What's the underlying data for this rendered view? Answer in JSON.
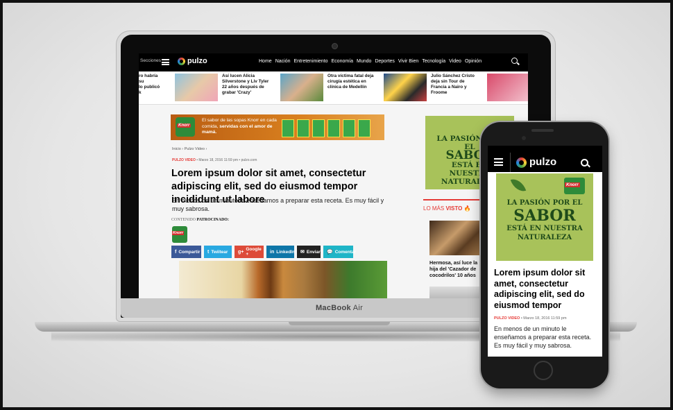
{
  "site": {
    "secciones": "Secciones",
    "logo": "pulzo",
    "nav": [
      "Home",
      "Nación",
      "Entretenimiento",
      "Economía",
      "Mundo",
      "Deportes",
      "Vivir Bien",
      "Tecnología",
      "Video",
      "Opinión"
    ]
  },
  "stories": [
    {
      "text": "ro habría\nsu\nlo publicó\nk"
    },
    {
      "text": "Así lucen Alicia Silverstone y Liv Tyler 22 años después de grabar 'Crazy'"
    },
    {
      "text": "Otra víctima fatal deja cirugía estética en clínica de Medellín"
    },
    {
      "text": "Julio Sánchez Cristo deja sin Tour de Francia a Nairo y Froome"
    }
  ],
  "banner_ad": {
    "brand": "Knorr",
    "text_plain": "El sabor de las sopas Knorr en cada comida,",
    "text_bold": "servidas con el amor de mamá."
  },
  "article": {
    "breadcrumb": "Inicio › Pulzo Video ›",
    "category": "PULZO VIDEO",
    "date_source": "• Marzo 18, 2016 11:59 pm • pulzo.com",
    "headline": "Lorem ipsum dolor sit amet, consectetur adipiscing elit, sed do eiusmod tempor incididunt ut labore",
    "dek": "En menos de un minuto le enseñamos a preparar esta receta. Es muy fácil y muy sabrosa.",
    "sponsored_label": "CONTENIDO",
    "sponsored_bold": "PATROCINADO:",
    "sponsor": "Knorr"
  },
  "share": [
    {
      "label": "Compartir",
      "icon": "f",
      "color": "#3b5998"
    },
    {
      "label": "Twiitear",
      "icon": "t",
      "color": "#29a9e1"
    },
    {
      "label": "Google +",
      "icon": "g+",
      "color": "#dd4b39"
    },
    {
      "label": "LinkedIn",
      "icon": "in",
      "color": "#0e76a8"
    },
    {
      "label": "Enviar",
      "icon": "✉",
      "color": "#222222"
    },
    {
      "label": "Comentar",
      "icon": "💬",
      "color": "#1fb5c7"
    }
  ],
  "side_ad": {
    "line1": "LA PASIÓN POR EL",
    "line2": "SABOR",
    "line3": "ESTÁ EN NUESTRA",
    "line4": "NATURALEZA"
  },
  "mas_visto": {
    "label": "LO MÁS",
    "label_bold": "VISTO",
    "story": "Hermosa, así luce la hija del 'Cazador de cocodrilos' 10 años"
  },
  "device": {
    "laptop_brand": "MacBook",
    "laptop_model": "Air"
  },
  "phone": {
    "logo": "pulzo",
    "ad_brand": "Knorr",
    "ad_line1": "LA PASIÓN POR EL",
    "ad_line2": "SABOR",
    "ad_line3": "ESTÁ EN NUESTRA",
    "ad_line4": "NATURALEZA",
    "headline": "Lorem ipsum dolor sit amet, consectetur adipiscing elit, sed do eiusmod tempor",
    "category": "PULZO VIDEO",
    "date": "• Marzo 18, 2016 11:59 pm",
    "dek": "En menos de un minuto le enseñamos a preparar esta receta. Es muy fácil y muy sabrosa."
  }
}
